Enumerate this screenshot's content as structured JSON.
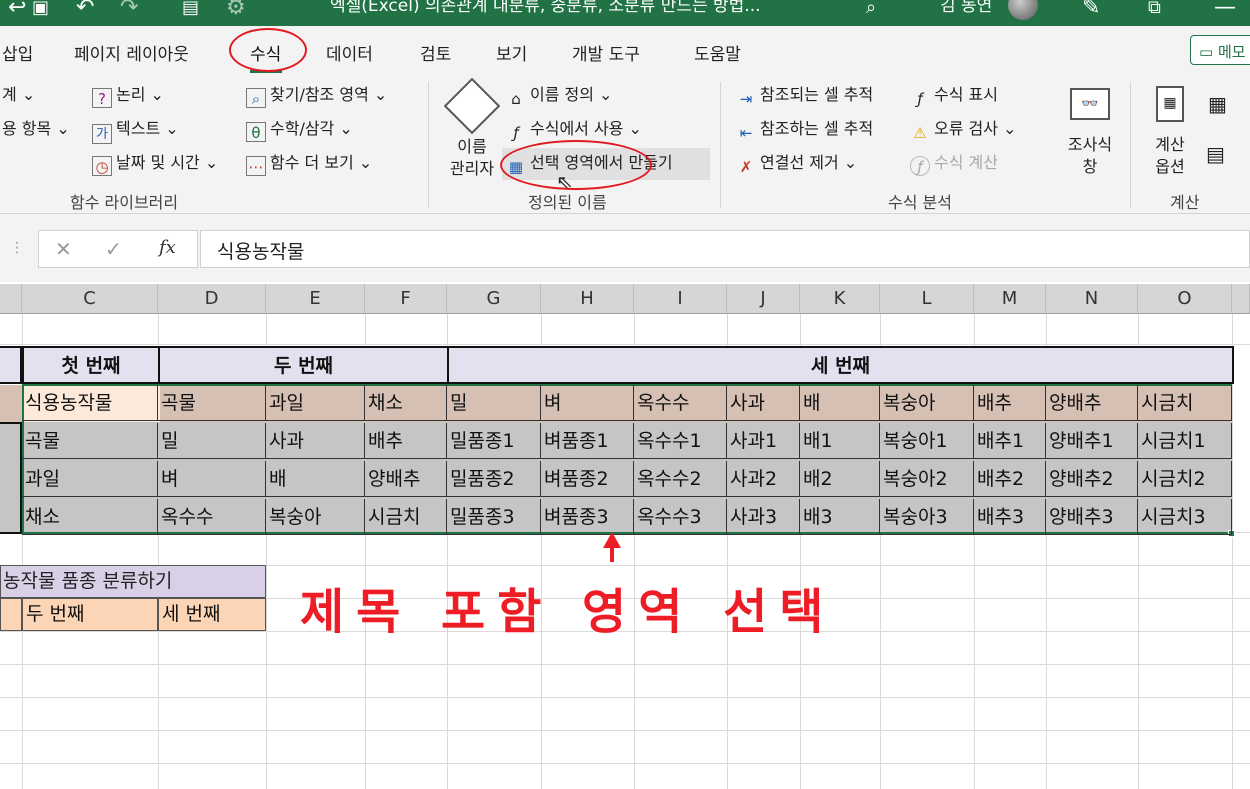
{
  "titlebar": {
    "title": "엑셀(Excel) 의존관계 대분류, 중분류, 소분류 만드는 방법...",
    "user": "김 동연"
  },
  "tabs": [
    "삽입",
    "페이지 레이아웃",
    "수식",
    "데이터",
    "검토",
    "보기",
    "개발 도구",
    "도움말"
  ],
  "active_tab": "수식",
  "memo_label": "메모",
  "ribbon": {
    "function_library": {
      "label": "함수 라이브러리",
      "left_items": [
        "계",
        "용 항목"
      ],
      "items": [
        "논리",
        "텍스트",
        "날짜 및 시간",
        "찾기/참조 영역",
        "수학/삼각",
        "함수 더 보기"
      ]
    },
    "defined_names": {
      "label": "정의된 이름",
      "name_manager": [
        "이름",
        "관리자"
      ],
      "define_name": "이름 정의",
      "use_in_formula": "수식에서 사용",
      "create_from_selection": "선택 영역에서 만들기"
    },
    "formula_auditing": {
      "label": "수식 분석",
      "trace_precedents": "참조되는 셀 추적",
      "trace_dependents": "참조하는 셀 추적",
      "remove_arrows": "연결선 제거",
      "show_formulas": "수식 표시",
      "error_checking": "오류 검사",
      "evaluate_formula": "수식 계산",
      "watch_window": [
        "조사식",
        "창"
      ]
    },
    "calculation": {
      "label": "계산",
      "options": [
        "계산",
        "옵션"
      ]
    }
  },
  "formula_bar": {
    "cancel": "✕",
    "enter": "✓",
    "fx": "fx",
    "value": "식용농작물"
  },
  "columns": [
    "C",
    "D",
    "E",
    "F",
    "G",
    "H",
    "I",
    "J",
    "K",
    "L",
    "M",
    "N",
    "O"
  ],
  "table": {
    "group_headers": [
      "첫 번째",
      "두 번째",
      "세 번째"
    ],
    "header_row": [
      "식용농작물",
      "곡물",
      "과일",
      "채소",
      "밀",
      "벼",
      "옥수수",
      "사과",
      "배",
      "복숭아",
      "배추",
      "양배추",
      "시금치"
    ],
    "rows": [
      [
        "곡물",
        "밀",
        "사과",
        "배추",
        "밀품종1",
        "벼품종1",
        "옥수수1",
        "사과1",
        "배1",
        "복숭아1",
        "배추1",
        "양배추1",
        "시금치1"
      ],
      [
        "과일",
        "벼",
        "배",
        "양배추",
        "밀품종2",
        "벼품종2",
        "옥수수2",
        "사과2",
        "배2",
        "복숭아2",
        "배추2",
        "양배추2",
        "시금치2"
      ],
      [
        "채소",
        "옥수수",
        "복숭아",
        "시금치",
        "밀품종3",
        "벼품종3",
        "옥수수3",
        "사과3",
        "배3",
        "복숭아3",
        "배추3",
        "양배추3",
        "시금치3"
      ]
    ]
  },
  "second_table": {
    "title": "농작물 품종 분류하기",
    "cols": [
      "두 번째",
      "세 번째"
    ]
  },
  "annotation": "제목 포함 영역 선택",
  "colors": {
    "excel_green": "#217346",
    "annotation_red": "#ee1c25",
    "header_fill": "#e4e0f0",
    "tan_fill": "#d6c0b4",
    "selection_fill": "#c5c5c5"
  }
}
